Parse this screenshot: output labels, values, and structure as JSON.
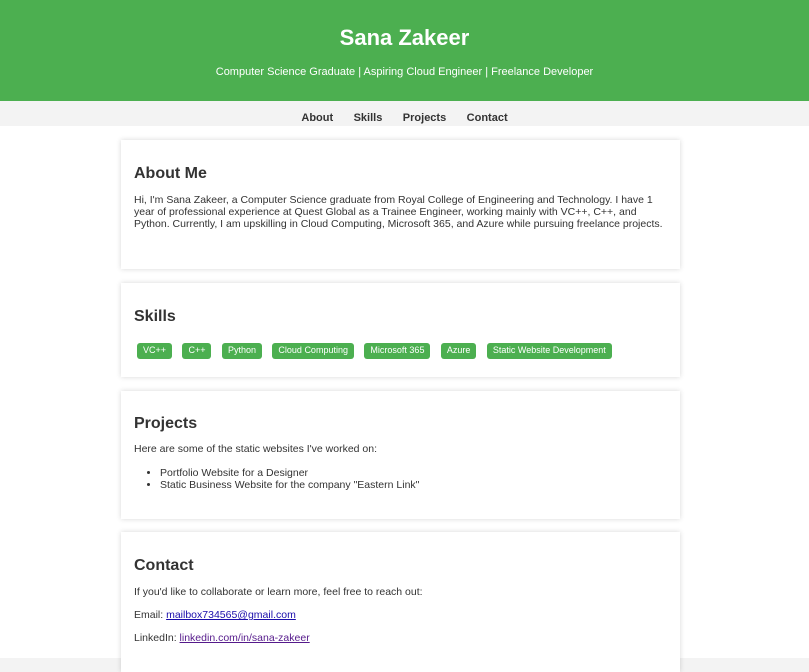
{
  "header": {
    "name": "Sana Zakeer",
    "tagline": "Computer Science Graduate | Aspiring Cloud Engineer | Freelance Developer"
  },
  "nav": {
    "items": [
      "About",
      "Skills",
      "Projects",
      "Contact"
    ]
  },
  "about": {
    "title": "About Me",
    "text": "Hi, I'm Sana Zakeer, a Computer Science graduate from Royal College of Engineering and Technology. I have 1 year of professional experience at Quest Global as a Trainee Engineer, working mainly with VC++, C++, and Python. Currently, I am upskilling in Cloud Computing, Microsoft 365, and Azure while pursuing freelance projects."
  },
  "skills": {
    "title": "Skills",
    "items": [
      "VC++",
      "C++",
      "Python",
      "Cloud Computing",
      "Microsoft 365",
      "Azure",
      "Static Website Development"
    ]
  },
  "projects": {
    "title": "Projects",
    "intro": "Here are some of the static websites I've worked on:",
    "items": [
      "Portfolio Website for a Designer",
      "Static Business Website for the company \"Eastern Link\""
    ]
  },
  "contact": {
    "title": "Contact",
    "intro": "If you'd like to collaborate or learn more, feel free to reach out:",
    "email_label": "Email: ",
    "email": "mailbox734565@gmail.com",
    "linkedin_label": "LinkedIn: ",
    "linkedin": "linkedin.com/in/sana-zakeer"
  },
  "colors": {
    "accent": "#4caf50",
    "text": "#333333",
    "link": "#1a0dab",
    "link_visited": "#551a8b"
  }
}
